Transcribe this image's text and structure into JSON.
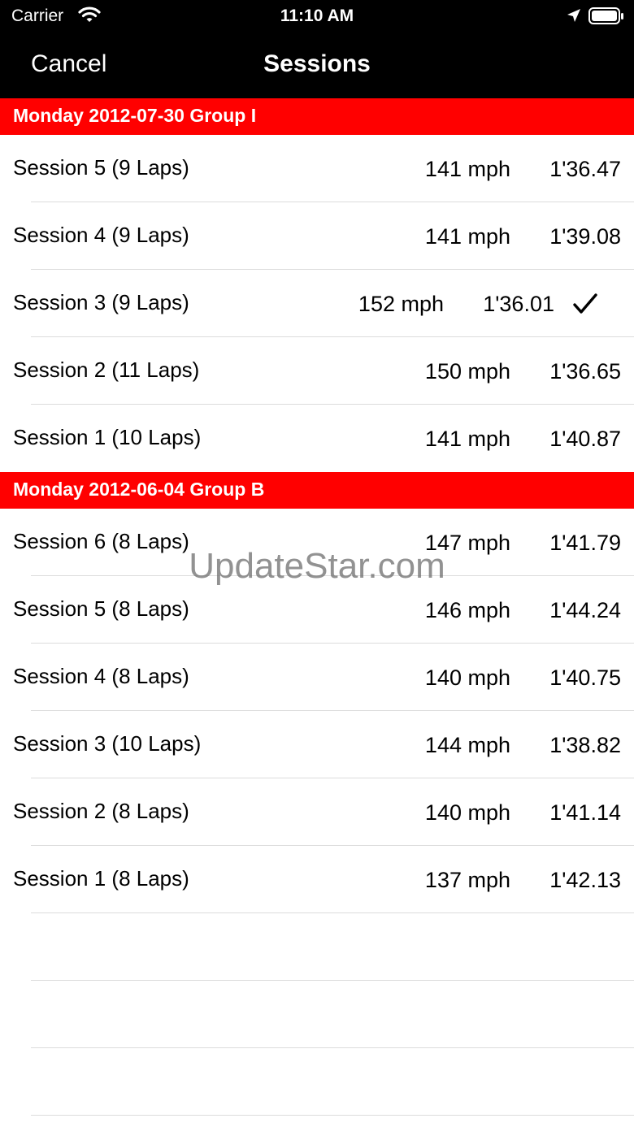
{
  "status_bar": {
    "carrier": "Carrier",
    "time": "11:10 AM",
    "icons": [
      "wifi-icon",
      "location-arrow-icon",
      "battery-icon"
    ]
  },
  "nav": {
    "cancel_label": "Cancel",
    "title": "Sessions"
  },
  "colors": {
    "section_header": "#ff0000",
    "nav_background": "#000000"
  },
  "sections": [
    {
      "header": "Monday 2012-07-30 Group I",
      "rows": [
        {
          "name": "Session 5 (9 Laps)",
          "speed": "141 mph",
          "time": "1'36.47"
        },
        {
          "name": "Session 4 (9 Laps)",
          "speed": "141 mph",
          "time": "1'39.08"
        },
        {
          "name": "Session 3 (9 Laps)",
          "speed": "152 mph",
          "time": "1'36.01"
        },
        {
          "name": "Session 2 (11 Laps)",
          "speed": "150 mph",
          "time": "1'36.65"
        },
        {
          "name": "Session 1 (10 Laps)",
          "speed": "141 mph",
          "time": "1'40.87"
        }
      ]
    },
    {
      "header": "Monday 2012-06-04 Group B",
      "rows": [
        {
          "name": "Session 6 (8 Laps)",
          "speed": "147 mph",
          "time": "1'41.79"
        },
        {
          "name": "Session 5 (8 Laps)",
          "speed": "146 mph",
          "time": "1'44.24"
        },
        {
          "name": "Session 4 (8 Laps)",
          "speed": "140 mph",
          "time": "1'40.75"
        },
        {
          "name": "Session 3 (10 Laps)",
          "speed": "144 mph",
          "time": "1'38.82"
        },
        {
          "name": "Session 2 (8 Laps)",
          "speed": "140 mph",
          "time": "1'41.14"
        },
        {
          "name": "Session 1 (8 Laps)",
          "speed": "137 mph",
          "time": "1'42.13"
        }
      ]
    }
  ],
  "selected_row": "Session 3 (9 Laps)",
  "watermark": "UpdateStar.com"
}
